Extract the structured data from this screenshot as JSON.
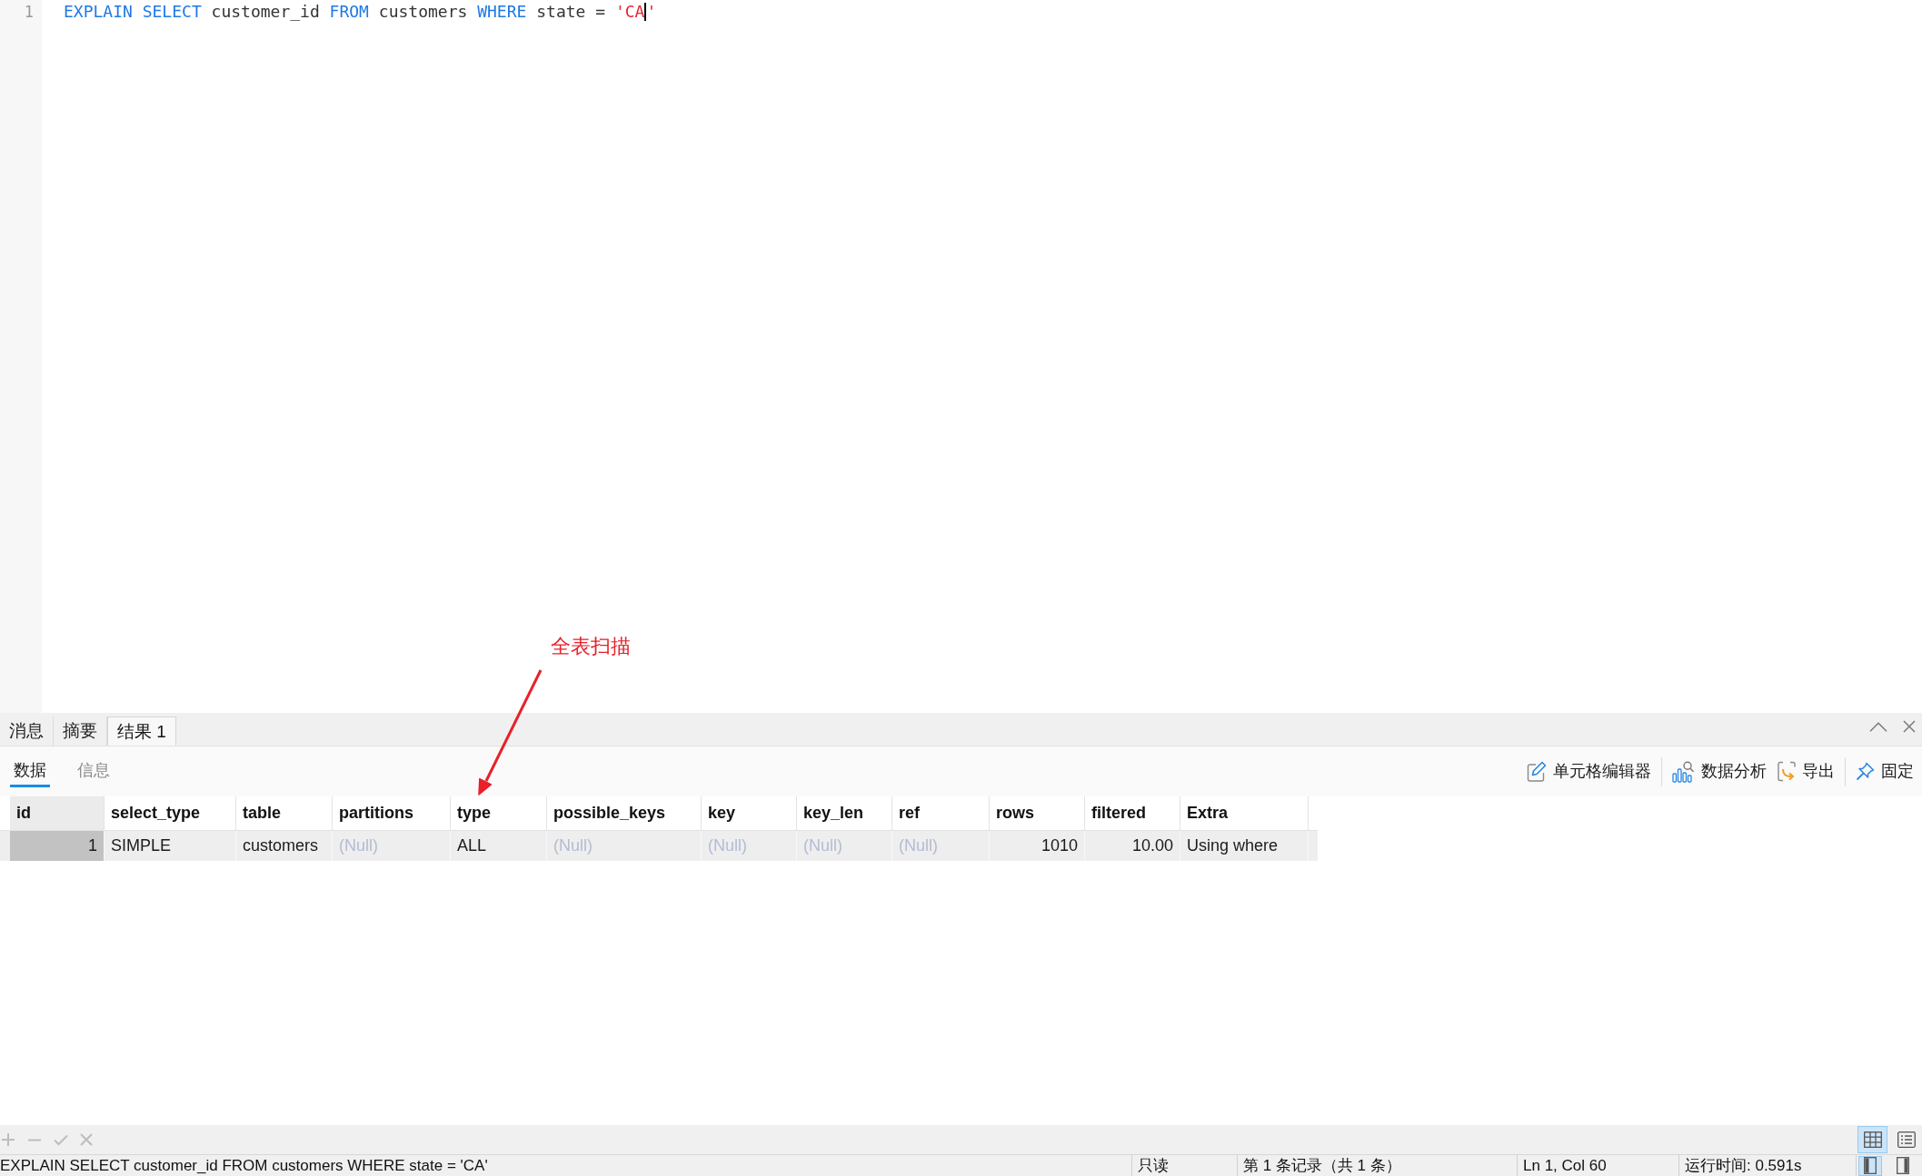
{
  "editor": {
    "lines": [
      {
        "number": "1",
        "tokens": [
          {
            "kind": "keyword",
            "text": "EXPLAIN SELECT"
          },
          {
            "kind": "plain",
            "text": " customer_id "
          },
          {
            "kind": "keyword",
            "text": "FROM"
          },
          {
            "kind": "plain",
            "text": " customers "
          },
          {
            "kind": "keyword",
            "text": "WHERE"
          },
          {
            "kind": "plain",
            "text": " state = "
          },
          {
            "kind": "string",
            "text": "'CA"
          },
          {
            "kind": "cursor"
          },
          {
            "kind": "string",
            "text": "'"
          }
        ]
      }
    ]
  },
  "annotation": {
    "text": "全表扫描"
  },
  "result_panel": {
    "tabs": [
      {
        "label": "消息",
        "selected": false
      },
      {
        "label": "摘要",
        "selected": false
      },
      {
        "label": "结果 1",
        "selected": true
      }
    ],
    "view_tabs": [
      {
        "label": "数据",
        "selected": true
      },
      {
        "label": "信息",
        "selected": false
      }
    ],
    "toolbar": [
      {
        "label": "单元格编辑器"
      },
      {
        "label": "数据分析"
      },
      {
        "label": "导出"
      },
      {
        "label": "固定"
      }
    ],
    "table": {
      "columns": [
        {
          "label": "id",
          "right_aligned": true
        },
        {
          "label": "select_type",
          "right_aligned": false
        },
        {
          "label": "table",
          "right_aligned": false
        },
        {
          "label": "partitions",
          "right_aligned": false
        },
        {
          "label": "type",
          "right_aligned": false
        },
        {
          "label": "possible_keys",
          "right_aligned": false
        },
        {
          "label": "key",
          "right_aligned": false
        },
        {
          "label": "key_len",
          "right_aligned": false
        },
        {
          "label": "ref",
          "right_aligned": false
        },
        {
          "label": "rows",
          "right_aligned": true
        },
        {
          "label": "filtered",
          "right_aligned": true
        },
        {
          "label": "Extra",
          "right_aligned": false
        }
      ],
      "rows": [
        {
          "selected": true,
          "cells": [
            {
              "text": "1",
              "null": false
            },
            {
              "text": "SIMPLE",
              "null": false
            },
            {
              "text": "customers",
              "null": false
            },
            {
              "text": "(Null)",
              "null": true
            },
            {
              "text": "ALL",
              "null": false
            },
            {
              "text": "(Null)",
              "null": true
            },
            {
              "text": "(Null)",
              "null": true
            },
            {
              "text": "(Null)",
              "null": true
            },
            {
              "text": "(Null)",
              "null": true
            },
            {
              "text": "1010",
              "null": false
            },
            {
              "text": "10.00",
              "null": false
            },
            {
              "text": "Using where",
              "null": false
            }
          ]
        }
      ]
    }
  },
  "record_toolbar": {
    "actions": [
      {
        "disabled": true
      },
      {
        "disabled": true
      },
      {
        "disabled": true
      },
      {
        "disabled": true
      }
    ],
    "view_modes": [
      {
        "selected": true
      },
      {
        "selected": false
      }
    ]
  },
  "status_bar": {
    "query": "EXPLAIN SELECT customer_id FROM customers WHERE state = 'CA'",
    "mode": "只读",
    "record": "第 1 条记录（共 1 条）",
    "position": "Ln 1, Col 60",
    "elapsed": "运行时间: 0.591s",
    "panes": [
      {
        "selected": true
      },
      {
        "selected": false
      }
    ]
  }
}
